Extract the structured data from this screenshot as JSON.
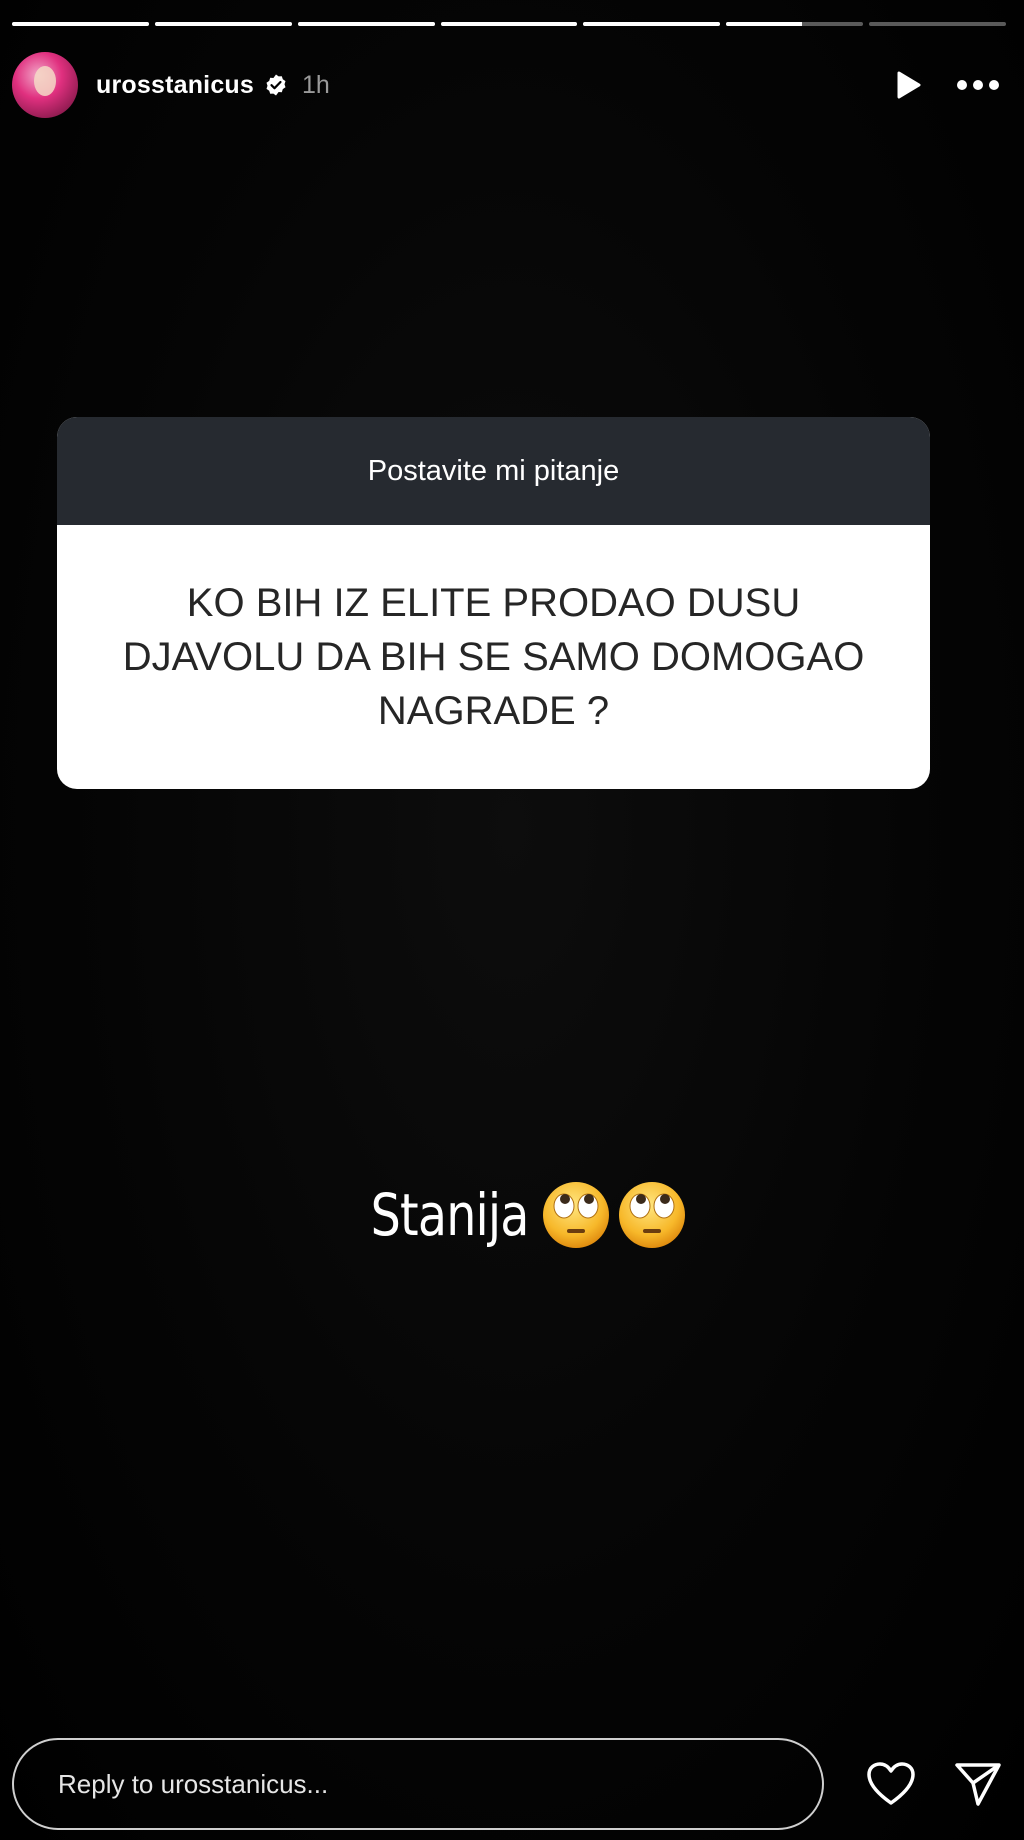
{
  "story": {
    "progress": [
      1,
      1,
      1,
      1,
      1,
      0.55,
      0
    ],
    "user": {
      "username": "urosstanicus",
      "verified": true,
      "time": "1h"
    },
    "icons": {
      "play": "play-icon",
      "more": "more-icon",
      "like": "heart-icon",
      "share": "send-icon",
      "verified": "verified-badge-icon"
    }
  },
  "question_sticker": {
    "header": "Postavite mi pitanje",
    "lines": [
      "KO BIH IZ ELITE PRODAO DUSU",
      "DJAVOLU DA BIH SE SAMO DOMOGAO",
      "NAGRADE ?"
    ]
  },
  "answer": {
    "text": "Stanija",
    "emojis": [
      "eye-roll-emoji",
      "eye-roll-emoji"
    ]
  },
  "reply": {
    "placeholder": "Reply to urosstanicus..."
  },
  "colors": {
    "sticker_header_bg": "#262a30",
    "sticker_body_bg": "#ffffff",
    "background": "#000000"
  }
}
